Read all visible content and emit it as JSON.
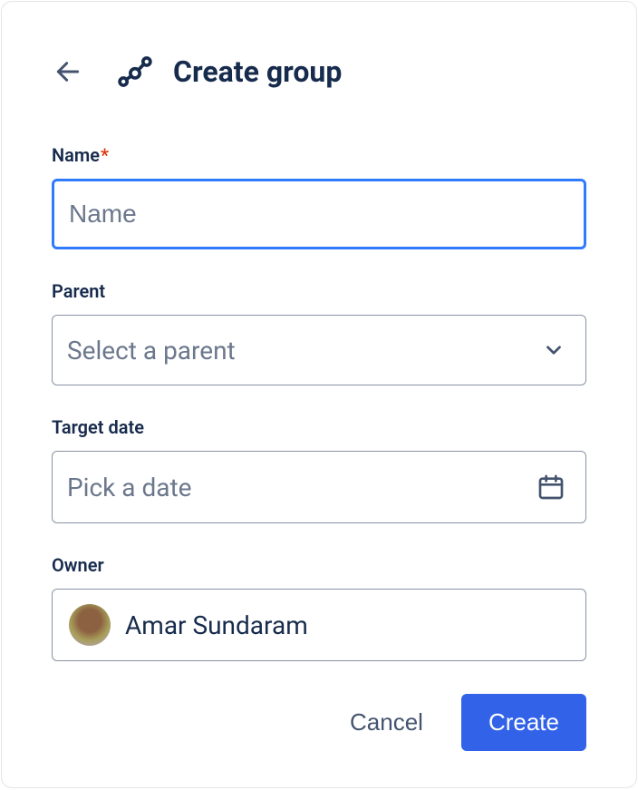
{
  "header": {
    "title": "Create group"
  },
  "fields": {
    "name": {
      "label": "Name",
      "placeholder": "Name",
      "value": "",
      "required": true
    },
    "parent": {
      "label": "Parent",
      "placeholder": "Select a parent"
    },
    "target_date": {
      "label": "Target date",
      "placeholder": "Pick a date"
    },
    "owner": {
      "label": "Owner",
      "value": "Amar Sundaram"
    }
  },
  "actions": {
    "cancel": "Cancel",
    "create": "Create"
  }
}
